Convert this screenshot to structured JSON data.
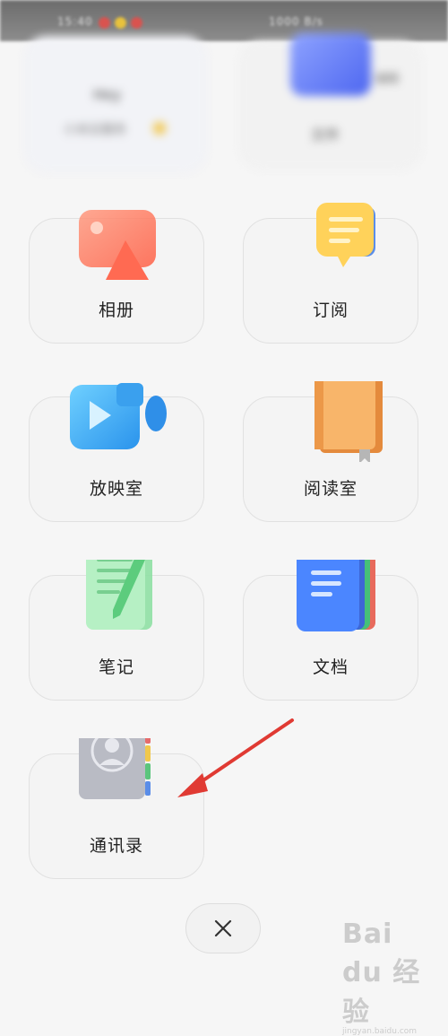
{
  "status_bar": {
    "time": "15:40",
    "right_text": "1000 B/s"
  },
  "tiles": [
    {
      "label": "相册",
      "icon": "photo-album-icon"
    },
    {
      "label": "订阅",
      "icon": "subscription-icon"
    },
    {
      "label": "放映室",
      "icon": "video-camera-icon"
    },
    {
      "label": "阅读室",
      "icon": "book-icon"
    },
    {
      "label": "笔记",
      "icon": "notes-pencil-icon"
    },
    {
      "label": "文档",
      "icon": "document-icon"
    },
    {
      "label": "通讯录",
      "icon": "contacts-book-icon"
    }
  ],
  "blurred_top": {
    "left_title": "Hey",
    "left_subtitle": "小米云服务",
    "right_title": "文件",
    "right_badge": "编辑"
  },
  "close": {
    "icon": "close-icon"
  },
  "annotation": {
    "color": "#e03a33"
  },
  "watermark": {
    "logo": "Bai du 经验",
    "url": "jingyan.baidu.com"
  }
}
